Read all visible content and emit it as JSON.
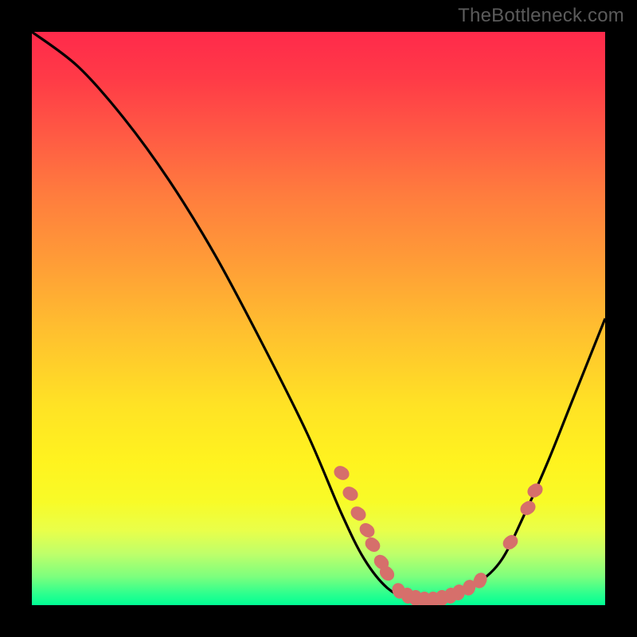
{
  "watermark": "TheBottleneck.com",
  "colors": {
    "background_frame": "#000000",
    "curve": "#000000",
    "dot": "#d66f6b",
    "gradient_top": "#ff2a4b",
    "gradient_mid": "#ffe225",
    "gradient_bottom": "#00ff94"
  },
  "chart_data": {
    "type": "line",
    "title": "",
    "xlabel": "",
    "ylabel": "",
    "xlim": [
      0,
      100
    ],
    "ylim": [
      0,
      100
    ],
    "grid": false,
    "legend": false,
    "curve_points": [
      {
        "x": 0,
        "y": 100
      },
      {
        "x": 8,
        "y": 94
      },
      {
        "x": 16,
        "y": 85
      },
      {
        "x": 24,
        "y": 74
      },
      {
        "x": 32,
        "y": 61
      },
      {
        "x": 40,
        "y": 46
      },
      {
        "x": 48,
        "y": 30
      },
      {
        "x": 54,
        "y": 16
      },
      {
        "x": 58,
        "y": 8
      },
      {
        "x": 62,
        "y": 3
      },
      {
        "x": 66,
        "y": 1
      },
      {
        "x": 70,
        "y": 1
      },
      {
        "x": 74,
        "y": 2
      },
      {
        "x": 78,
        "y": 4
      },
      {
        "x": 82,
        "y": 8
      },
      {
        "x": 86,
        "y": 16
      },
      {
        "x": 90,
        "y": 25
      },
      {
        "x": 94,
        "y": 35
      },
      {
        "x": 100,
        "y": 50
      }
    ],
    "data_markers": [
      {
        "x": 54,
        "y": 23,
        "rot": -58
      },
      {
        "x": 55.5,
        "y": 19.5,
        "rot": -58
      },
      {
        "x": 57,
        "y": 16,
        "rot": -55
      },
      {
        "x": 58.5,
        "y": 13,
        "rot": -52
      },
      {
        "x": 59.5,
        "y": 10.5,
        "rot": -50
      },
      {
        "x": 61,
        "y": 7.5,
        "rot": -46
      },
      {
        "x": 62,
        "y": 5.5,
        "rot": -42
      },
      {
        "x": 64,
        "y": 2.5,
        "rot": -22
      },
      {
        "x": 65.5,
        "y": 1.6,
        "rot": -10
      },
      {
        "x": 67,
        "y": 1.2,
        "rot": 0
      },
      {
        "x": 68.5,
        "y": 1.0,
        "rot": 0
      },
      {
        "x": 70,
        "y": 1.0,
        "rot": 0
      },
      {
        "x": 71.5,
        "y": 1.2,
        "rot": 0
      },
      {
        "x": 73,
        "y": 1.6,
        "rot": 8
      },
      {
        "x": 74.5,
        "y": 2.2,
        "rot": 12
      },
      {
        "x": 76.3,
        "y": 3.1,
        "rot": 18
      },
      {
        "x": 78.2,
        "y": 4.3,
        "rot": 24
      },
      {
        "x": 83.5,
        "y": 11,
        "rot": 50
      },
      {
        "x": 86.5,
        "y": 17,
        "rot": 55
      },
      {
        "x": 87.8,
        "y": 20,
        "rot": 57
      }
    ]
  }
}
